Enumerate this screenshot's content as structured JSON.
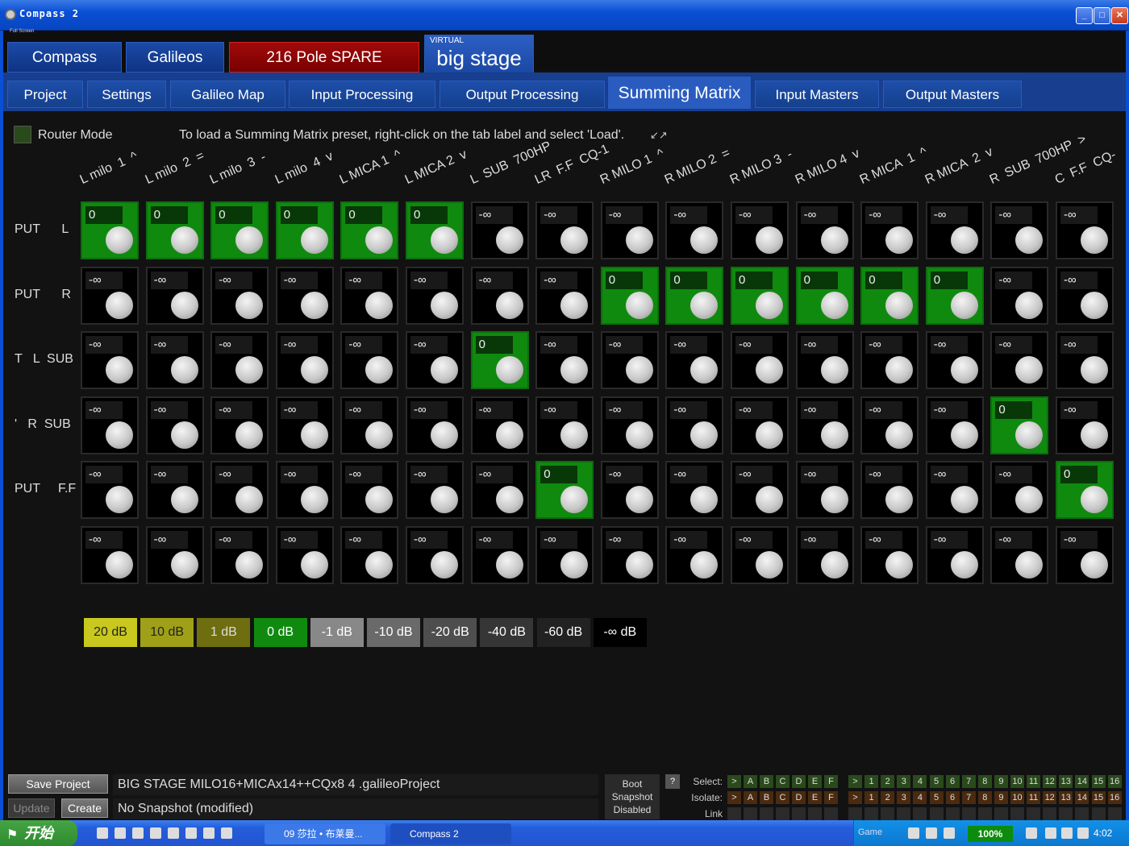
{
  "window": {
    "title": "Compass  2",
    "fullscreen_label": "Full Screen"
  },
  "top_tabs": [
    {
      "label": "Compass"
    },
    {
      "label": "Galileos"
    },
    {
      "label": "216 Pole SPARE"
    },
    {
      "label": "big stage",
      "sublabel": "VIRTUAL",
      "selected": true
    }
  ],
  "sub_tabs": [
    {
      "label": "Project"
    },
    {
      "label": "Settings"
    },
    {
      "label": "Galileo Map"
    },
    {
      "label": "Input Processing"
    },
    {
      "label": "Output Processing"
    },
    {
      "label": "Summing Matrix",
      "selected": true
    },
    {
      "label": "Input Masters"
    },
    {
      "label": "Output Masters"
    }
  ],
  "router": {
    "label": "Router Mode",
    "checked": false
  },
  "hint": "To load a Summing Matrix preset, right-click on the tab label and select 'Load'.",
  "columns": [
    "L milo  1  ^",
    "L milo  2  =",
    "L milo  3  -",
    "L milo  4  v",
    "L MICA 1  ^",
    "L MICA 2  v",
    "L  SUB  700HP",
    "LR  F.F  CQ-1",
    "R MILO 1  ^",
    "R MILO 2  =",
    "R MILO 3  -",
    "R MILO 4  v",
    "R MICA  1  ^",
    "R MICA  2  v",
    "R  SUB  700HP  >",
    "C  F.F  CQ-"
  ],
  "rows": [
    {
      "label": "PUT      L",
      "values": [
        "0",
        "0",
        "0",
        "0",
        "0",
        "0",
        "-∞",
        "-∞",
        "-∞",
        "-∞",
        "-∞",
        "-∞",
        "-∞",
        "-∞",
        "-∞",
        "-∞"
      ]
    },
    {
      "label": "PUT      R",
      "values": [
        "-∞",
        "-∞",
        "-∞",
        "-∞",
        "-∞",
        "-∞",
        "-∞",
        "-∞",
        "0",
        "0",
        "0",
        "0",
        "0",
        "0",
        "-∞",
        "-∞"
      ]
    },
    {
      "label": "T   L  SUB",
      "values": [
        "-∞",
        "-∞",
        "-∞",
        "-∞",
        "-∞",
        "-∞",
        "0",
        "-∞",
        "-∞",
        "-∞",
        "-∞",
        "-∞",
        "-∞",
        "-∞",
        "-∞",
        "-∞"
      ]
    },
    {
      "label": "'   R  SUB",
      "values": [
        "-∞",
        "-∞",
        "-∞",
        "-∞",
        "-∞",
        "-∞",
        "-∞",
        "-∞",
        "-∞",
        "-∞",
        "-∞",
        "-∞",
        "-∞",
        "-∞",
        "0",
        "-∞"
      ]
    },
    {
      "label": "PUT     F.F",
      "values": [
        "-∞",
        "-∞",
        "-∞",
        "-∞",
        "-∞",
        "-∞",
        "-∞",
        "0",
        "-∞",
        "-∞",
        "-∞",
        "-∞",
        "-∞",
        "-∞",
        "-∞",
        "0"
      ]
    },
    {
      "label": "",
      "values": [
        "-∞",
        "-∞",
        "-∞",
        "-∞",
        "-∞",
        "-∞",
        "-∞",
        "-∞",
        "-∞",
        "-∞",
        "-∞",
        "-∞",
        "-∞",
        "-∞",
        "-∞",
        "-∞"
      ]
    }
  ],
  "levels": [
    {
      "label": "20 dB",
      "bg": "#c8c81e",
      "fg": "#222"
    },
    {
      "label": "10 dB",
      "bg": "#a0a018",
      "fg": "#222"
    },
    {
      "label": "1 dB",
      "bg": "#6e6e10",
      "fg": "#ddd"
    },
    {
      "label": "0 dB",
      "bg": "#0f8a0f",
      "fg": "#fff"
    },
    {
      "label": "-1 dB",
      "bg": "#888888",
      "fg": "#fff"
    },
    {
      "label": "-10 dB",
      "bg": "#6a6a6a",
      "fg": "#fff"
    },
    {
      "label": "-20 dB",
      "bg": "#4e4e4e",
      "fg": "#fff"
    },
    {
      "label": "-40 dB",
      "bg": "#363636",
      "fg": "#fff"
    },
    {
      "label": "-60 dB",
      "bg": "#222222",
      "fg": "#fff"
    },
    {
      "label": "-∞ dB",
      "bg": "#000000",
      "fg": "#fff"
    }
  ],
  "footer": {
    "save_label": "Save Project",
    "update_label": "Update",
    "create_label": "Create",
    "project_name": "BIG STAGE MILO16+MICAx14++CQx8 4 .galileoProject",
    "snapshot": "No Snapshot (modified)",
    "boot_snapshot": [
      "Boot",
      "Snapshot",
      "Disabled"
    ],
    "help_label": "?",
    "select_label": "Select:",
    "isolate_label": "Isolate:",
    "link_label": "Link Group:",
    "group_letters": [
      ">",
      "A",
      "B",
      "C",
      "D",
      "E",
      "F"
    ],
    "group_numbers": [
      ">",
      "1",
      "2",
      "3",
      "4",
      "5",
      "6",
      "7",
      "8",
      "9",
      "10",
      "11",
      "12",
      "13",
      "14",
      "15",
      "16"
    ]
  },
  "taskbar": {
    "start_label": "开始",
    "tasks": [
      "09 莎拉 • 布莱曼...",
      "Compass 2"
    ],
    "tray_game": "Game",
    "zoom": "100%",
    "clock": "4:02"
  },
  "colors": {
    "title_blue": "#0a4fd4",
    "tab_blue": "#1c4aa8",
    "active_green": "#0f8a0f",
    "spare_red": "#a00a0a"
  }
}
